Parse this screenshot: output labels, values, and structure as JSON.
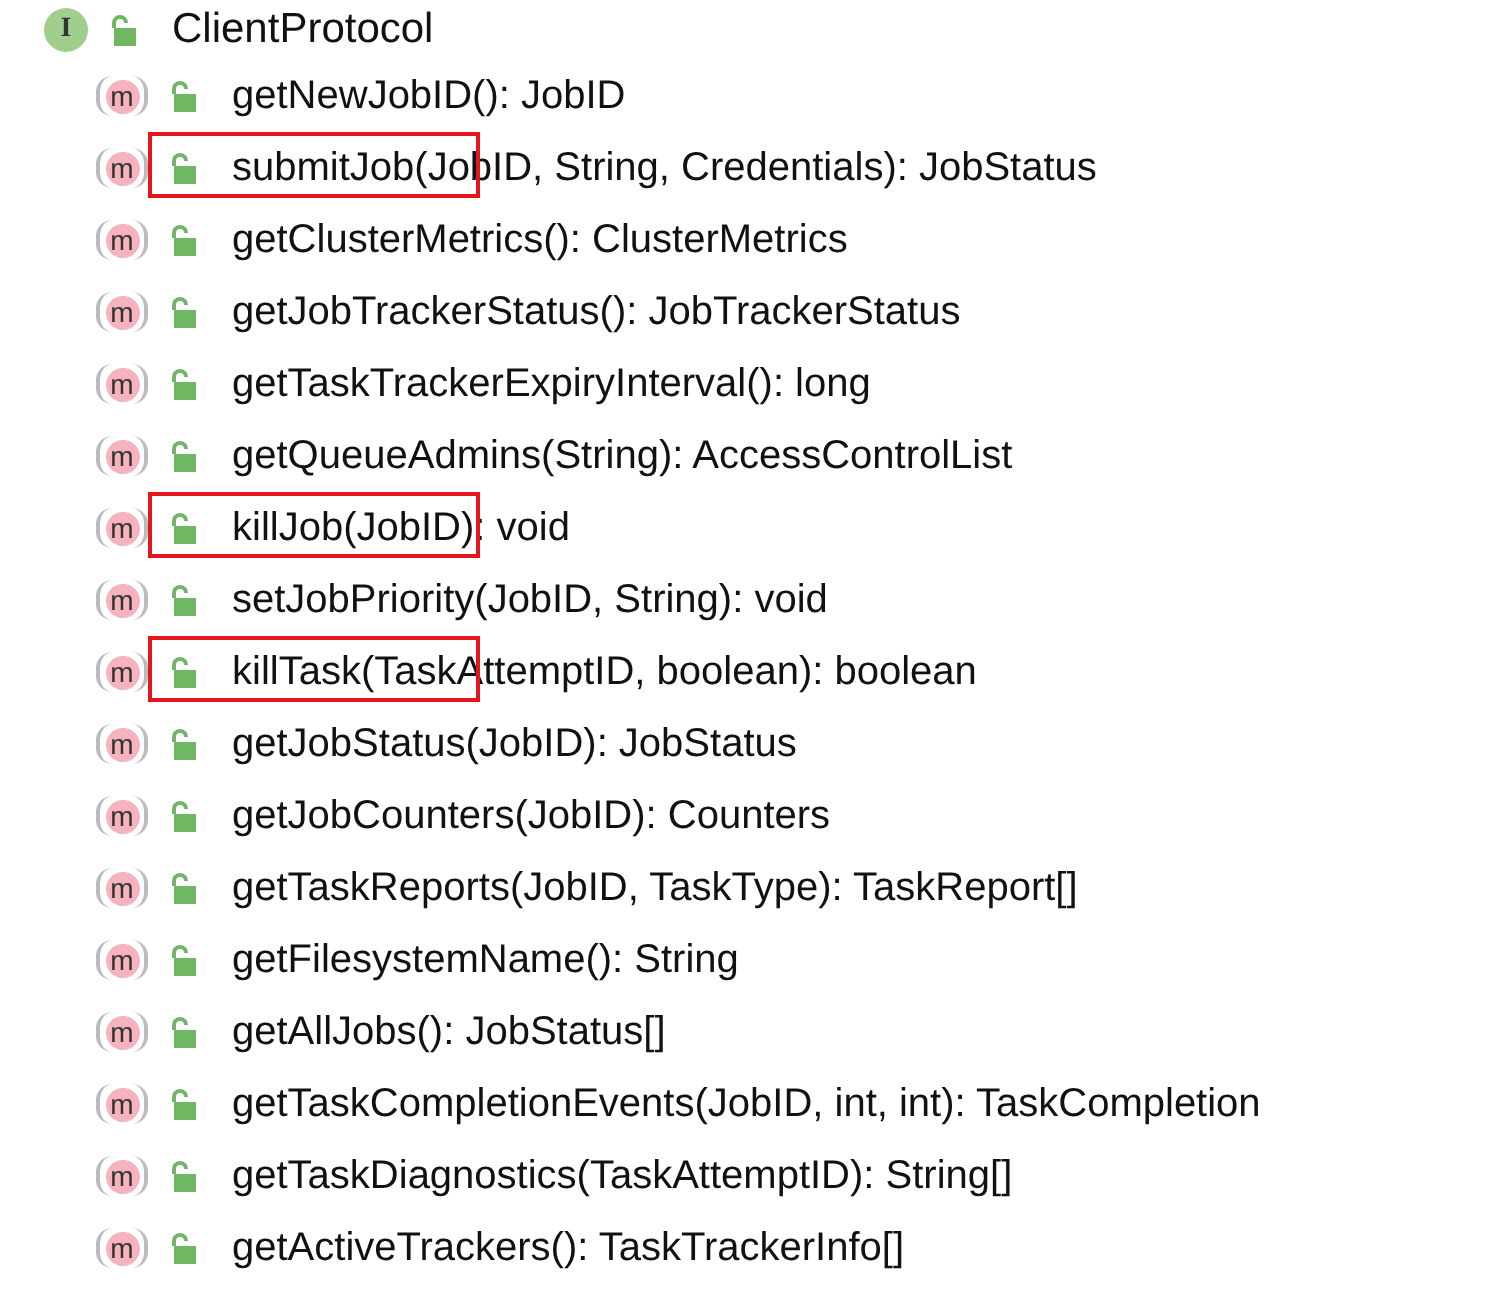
{
  "tree": {
    "root": {
      "badge": "I",
      "label": "ClientProtocol"
    },
    "children": [
      {
        "badge": "m",
        "label": "getNewJobID(): JobID",
        "highlighted": false
      },
      {
        "badge": "m",
        "label": "submitJob(JobID, String, Credentials): JobStatus",
        "highlighted": true
      },
      {
        "badge": "m",
        "label": "getClusterMetrics(): ClusterMetrics",
        "highlighted": false
      },
      {
        "badge": "m",
        "label": "getJobTrackerStatus(): JobTrackerStatus",
        "highlighted": false
      },
      {
        "badge": "m",
        "label": "getTaskTrackerExpiryInterval(): long",
        "highlighted": false
      },
      {
        "badge": "m",
        "label": "getQueueAdmins(String): AccessControlList",
        "highlighted": false
      },
      {
        "badge": "m",
        "label": "killJob(JobID): void",
        "highlighted": true
      },
      {
        "badge": "m",
        "label": "setJobPriority(JobID, String): void",
        "highlighted": false
      },
      {
        "badge": "m",
        "label": "killTask(TaskAttemptID, boolean): boolean",
        "highlighted": true
      },
      {
        "badge": "m",
        "label": "getJobStatus(JobID): JobStatus",
        "highlighted": false
      },
      {
        "badge": "m",
        "label": "getJobCounters(JobID): Counters",
        "highlighted": false
      },
      {
        "badge": "m",
        "label": "getTaskReports(JobID, TaskType): TaskReport[]",
        "highlighted": false
      },
      {
        "badge": "m",
        "label": "getFilesystemName(): String",
        "highlighted": false
      },
      {
        "badge": "m",
        "label": "getAllJobs(): JobStatus[]",
        "highlighted": false
      },
      {
        "badge": "m",
        "label": "getTaskCompletionEvents(JobID, int, int): TaskCompletion",
        "highlighted": false
      },
      {
        "badge": "m",
        "label": "getTaskDiagnostics(TaskAttemptID): String[]",
        "highlighted": false
      },
      {
        "badge": "m",
        "label": "getActiveTrackers(): TaskTrackerInfo[]",
        "highlighted": false
      }
    ]
  }
}
